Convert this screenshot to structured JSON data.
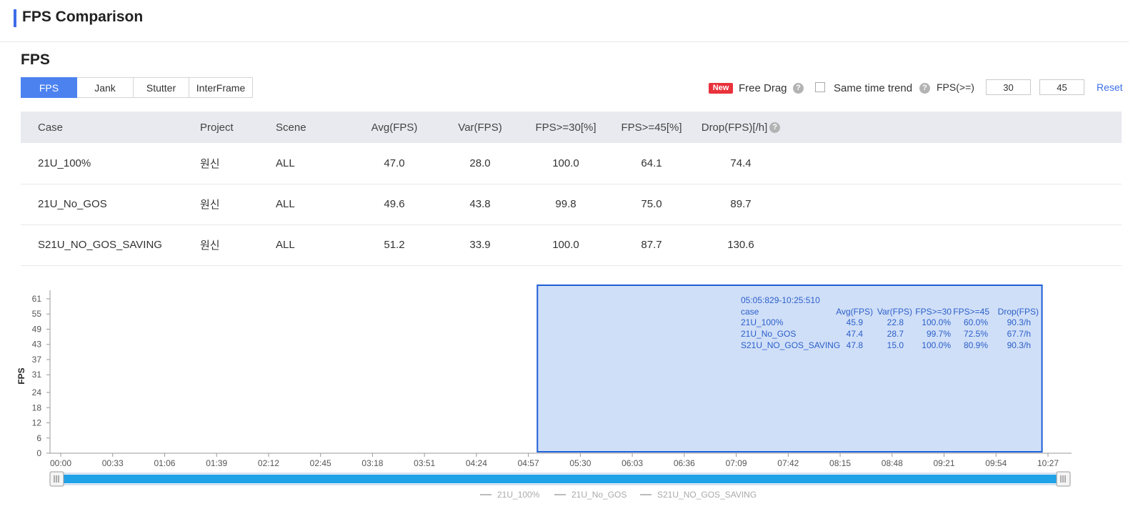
{
  "header": {
    "title": "FPS Comparison"
  },
  "section": {
    "title": "FPS"
  },
  "tabs": [
    {
      "label": "FPS",
      "active": true
    },
    {
      "label": "Jank",
      "active": false
    },
    {
      "label": "Stutter",
      "active": false
    },
    {
      "label": "InterFrame",
      "active": false
    }
  ],
  "controls": {
    "new_badge": "New",
    "free_drag_label": "Free Drag",
    "same_time_label": "Same time trend",
    "same_time_checked": false,
    "fps_ge_label": "FPS(>=)",
    "threshold_1": "30",
    "threshold_2": "45",
    "reset_label": "Reset",
    "help_glyph": "?"
  },
  "table": {
    "columns": [
      "Case",
      "Project",
      "Scene",
      "Avg(FPS)",
      "Var(FPS)",
      "FPS>=30[%]",
      "FPS>=45[%]",
      "Drop(FPS)[/h]"
    ],
    "rows": [
      [
        "21U_100%",
        "원신",
        "ALL",
        "47.0",
        "28.0",
        "100.0",
        "64.1",
        "74.4"
      ],
      [
        "21U_No_GOS",
        "원신",
        "ALL",
        "49.6",
        "43.8",
        "99.8",
        "75.0",
        "89.7"
      ],
      [
        "S21U_NO_GOS_SAVING",
        "원신",
        "ALL",
        "51.2",
        "33.9",
        "100.0",
        "87.7",
        "130.6"
      ]
    ]
  },
  "chart_data": {
    "type": "line",
    "ylabel": "FPS",
    "xlabel": "",
    "yticks": [
      "0",
      "6",
      "12",
      "18",
      "24",
      "31",
      "37",
      "43",
      "49",
      "55",
      "61"
    ],
    "xticks": [
      "00:00",
      "00:33",
      "01:06",
      "01:39",
      "02:12",
      "02:45",
      "03:18",
      "03:51",
      "04:24",
      "04:57",
      "05:30",
      "06:03",
      "06:36",
      "07:09",
      "07:42",
      "08:15",
      "08:48",
      "09:21",
      "09:54",
      "10:27"
    ],
    "series": [
      {
        "name": "21U_100%",
        "values": []
      },
      {
        "name": "21U_No_GOS",
        "values": []
      },
      {
        "name": "S21U_NO_GOS_SAVING",
        "values": []
      }
    ],
    "selection": {
      "range_label": "05:05:829-10:25:510",
      "start": "05:05",
      "end": "10:25",
      "columns": [
        "case",
        "Avg(FPS)",
        "Var(FPS)",
        "FPS>=30",
        "FPS>=45",
        "Drop(FPS)"
      ],
      "rows": [
        [
          "21U_100%",
          "45.9",
          "22.8",
          "100.0%",
          "60.0%",
          "90.3/h"
        ],
        [
          "21U_No_GOS",
          "47.4",
          "28.7",
          "99.7%",
          "72.5%",
          "67.7/h"
        ],
        [
          "S21U_NO_GOS_SAVING",
          "47.8",
          "15.0",
          "100.0%",
          "80.9%",
          "90.3/h"
        ]
      ]
    },
    "colors": {
      "selection_fill": "#d0dff8",
      "selection_stroke": "#1f5fd6",
      "selection_text": "#2a5fc9",
      "slider": "#1fa2e8"
    }
  }
}
